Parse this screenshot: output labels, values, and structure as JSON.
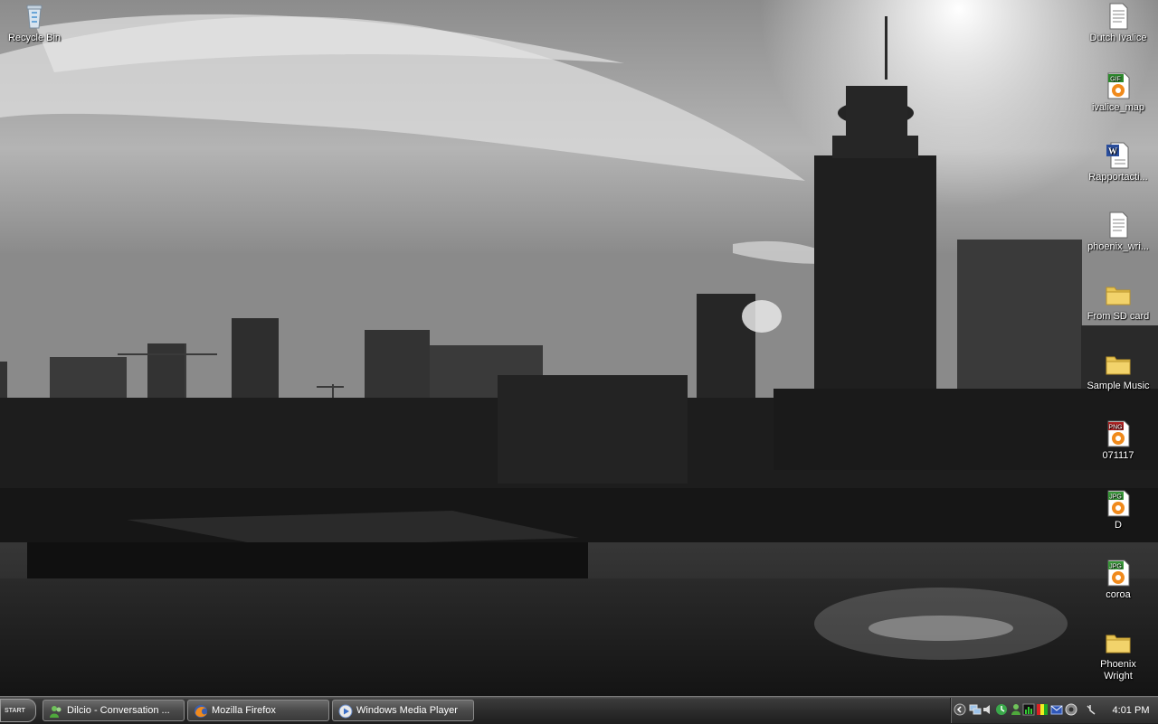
{
  "desktop": {
    "left_icons": [
      {
        "label": "Recycle Bin",
        "icon": "recycle-bin-icon"
      }
    ],
    "right_icons": [
      {
        "label": "Dutch Ivalice",
        "icon": "text-document-icon"
      },
      {
        "label": "ivalice_map",
        "icon": "gif-image-icon",
        "badge": "GIF"
      },
      {
        "label": "Rapportacti...",
        "icon": "word-document-icon"
      },
      {
        "label": "phoenix_wri...",
        "icon": "text-document-icon"
      },
      {
        "label": "From SD card",
        "icon": "folder-icon"
      },
      {
        "label": "Sample Music",
        "icon": "folder-icon"
      },
      {
        "label": "071117",
        "icon": "png-image-icon",
        "badge": "PNG"
      },
      {
        "label": "D",
        "icon": "jpg-image-icon",
        "badge": "JPG"
      },
      {
        "label": "coroa",
        "icon": "jpg-image-icon",
        "badge": "JPG"
      },
      {
        "label": "Phoenix Wright",
        "icon": "folder-icon"
      }
    ]
  },
  "taskbar": {
    "start_label": "START",
    "tasks": [
      {
        "label": "Dilcio - Conversation ...",
        "icon": "messenger-icon"
      },
      {
        "label": "Mozilla Firefox",
        "icon": "firefox-icon"
      },
      {
        "label": "Windows Media Player",
        "icon": "media-player-icon"
      }
    ],
    "tray": {
      "clock": "4:01 PM",
      "icons": [
        "chevron-left-icon",
        "network-icon",
        "volume-icon",
        "messenger-status-icon",
        "user-icon",
        "monitor-icon",
        "color-bars-icon",
        "mail-icon",
        "shield-icon",
        "power-icon"
      ]
    }
  },
  "colors": {
    "badge_gif": "#2e8b2e",
    "badge_png": "#b22222",
    "badge_jpg": "#3a9a3a",
    "folder": "#f2d36b",
    "media_orange": "#f08a1c"
  }
}
